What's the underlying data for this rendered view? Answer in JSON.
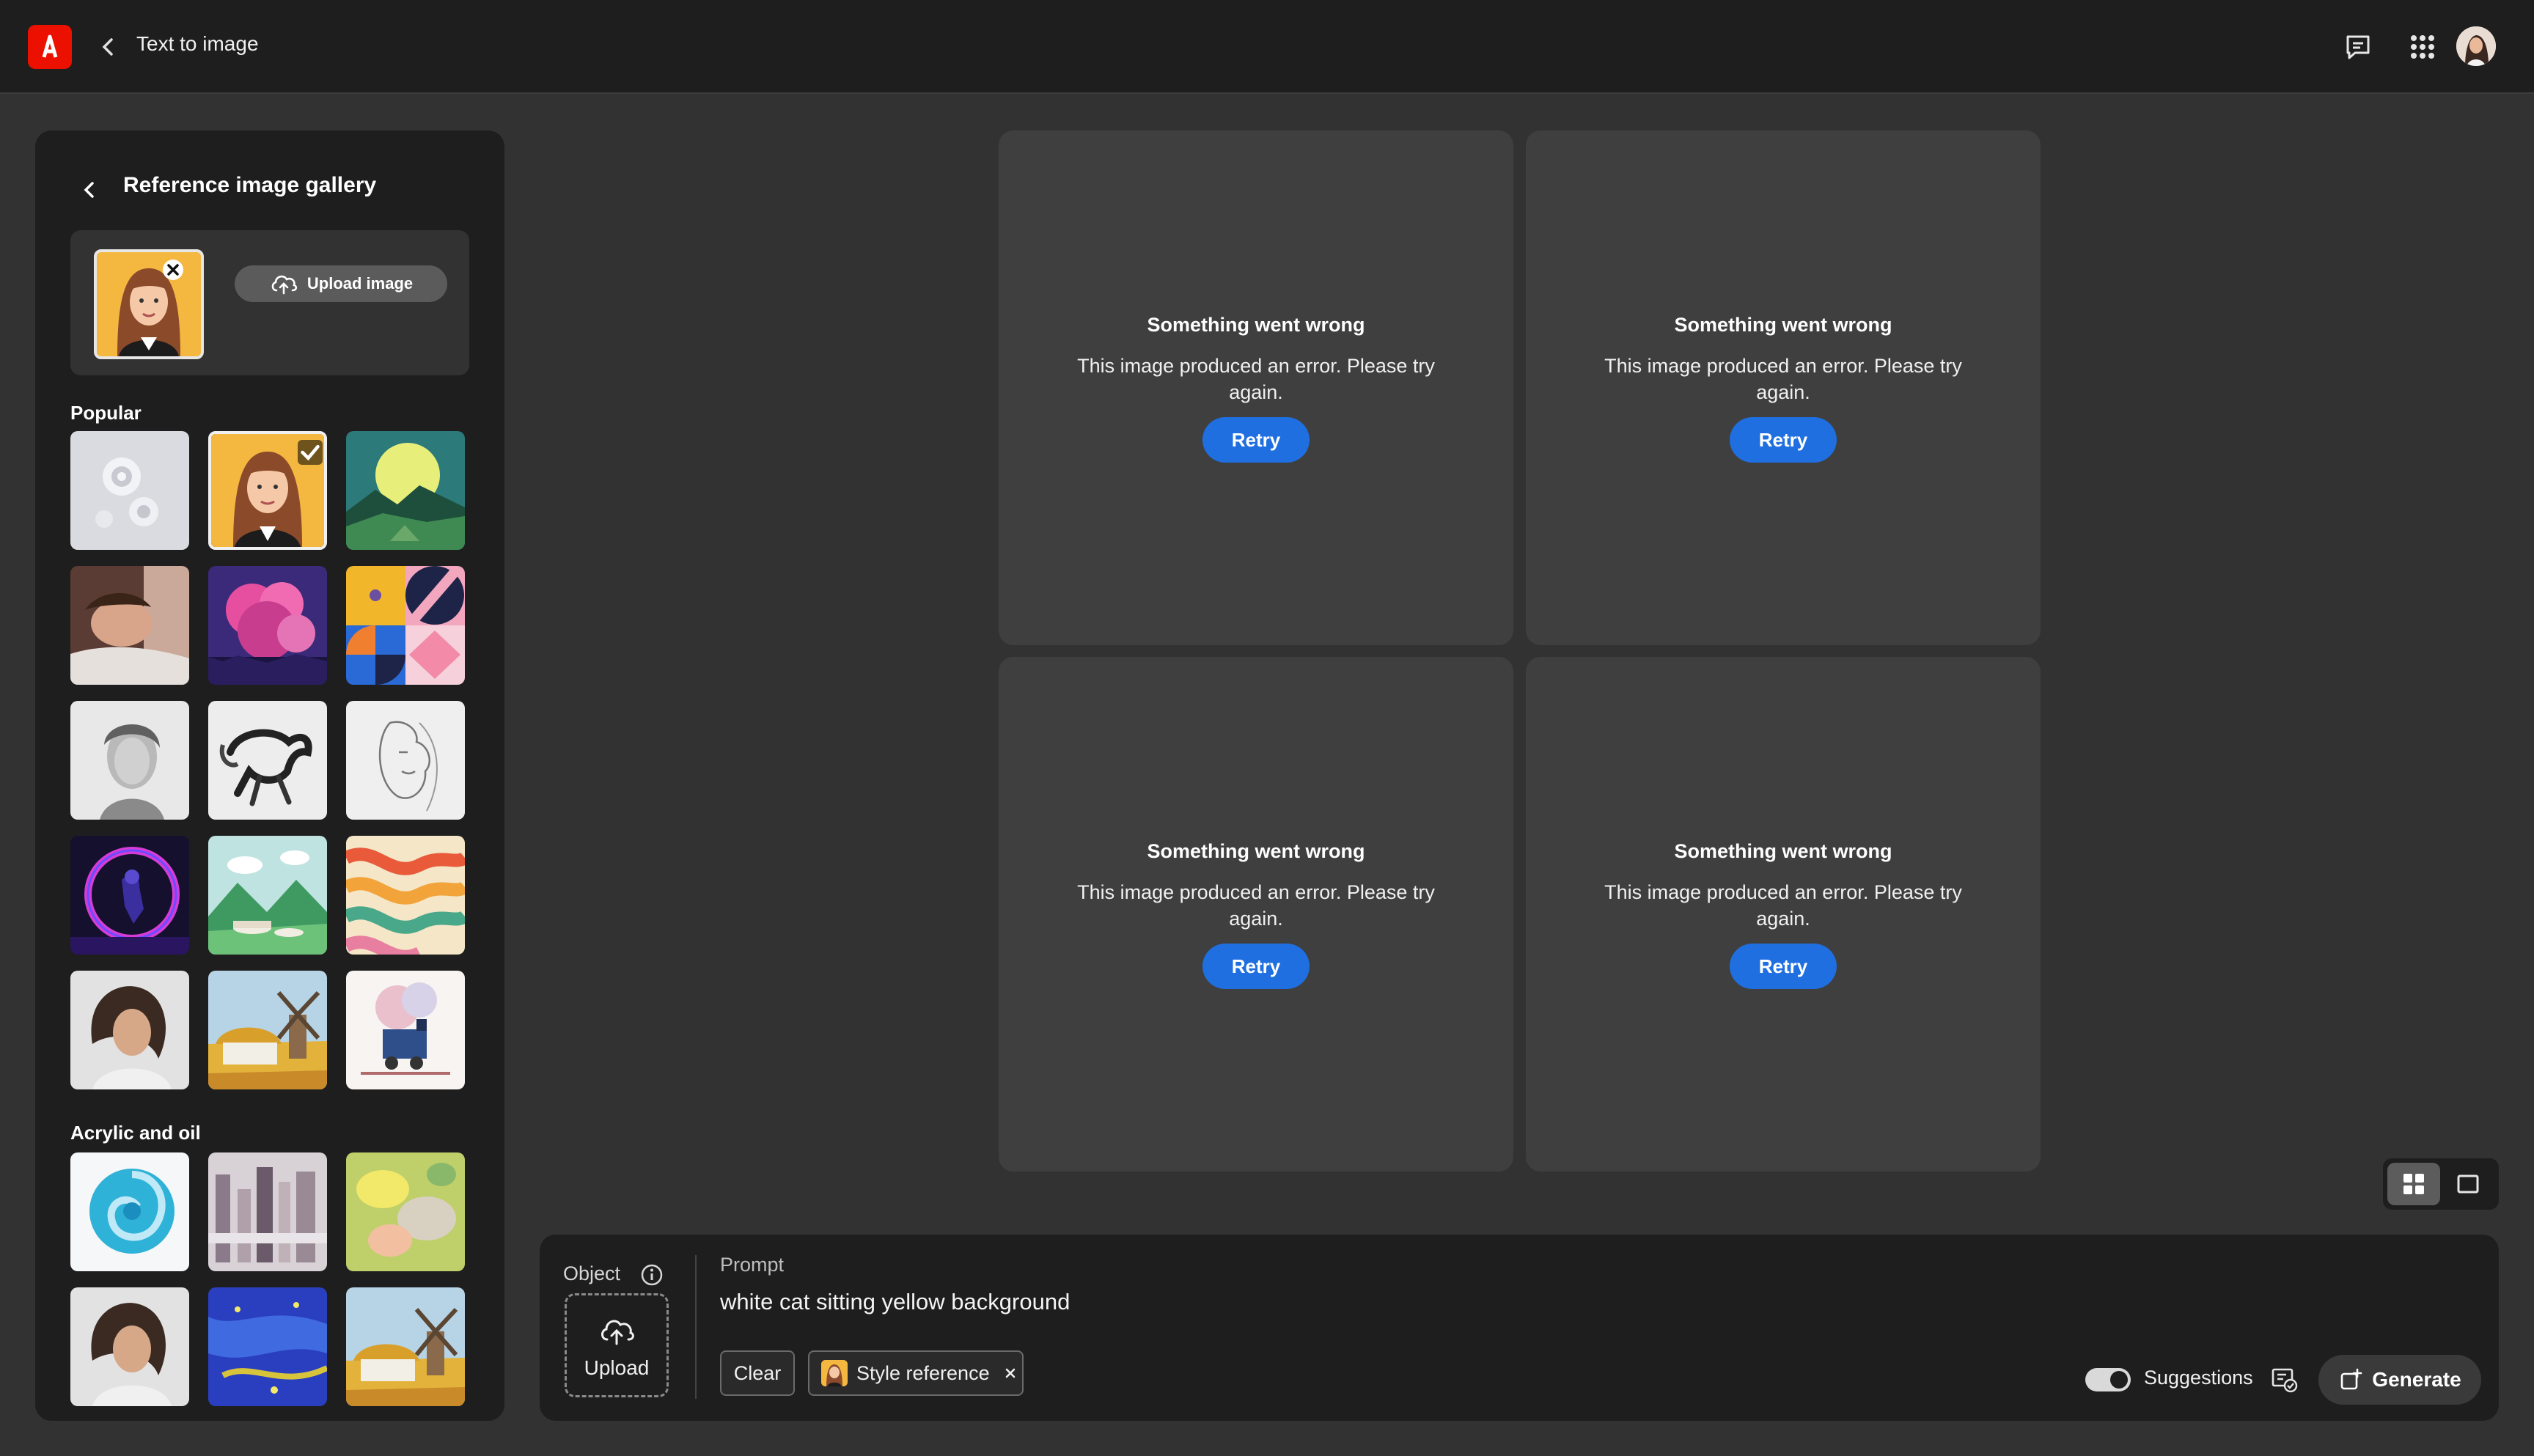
{
  "topbar": {
    "title": "Text to image"
  },
  "gallery": {
    "title": "Reference image gallery",
    "upload_label": "Upload image",
    "sections": {
      "popular": "Popular",
      "acrylic": "Acrylic and oil"
    }
  },
  "results": {
    "cards": [
      {
        "title": "Something went wrong",
        "message": "This image produced an error. Please try again.",
        "retry": "Retry"
      },
      {
        "title": "Something went wrong",
        "message": "This image produced an error. Please try again.",
        "retry": "Retry"
      },
      {
        "title": "Something went wrong",
        "message": "This image produced an error. Please try again.",
        "retry": "Retry"
      },
      {
        "title": "Something went wrong",
        "message": "This image produced an error. Please try again.",
        "retry": "Retry"
      }
    ]
  },
  "prompt": {
    "object_label": "Object",
    "upload_label": "Upload",
    "label": "Prompt",
    "text": "white cat sitting yellow background",
    "clear_label": "Clear",
    "style_chip": "Style reference",
    "suggestions_label": "Suggestions",
    "generate_label": "Generate"
  },
  "colors": {
    "accent_blue": "#1f6fe0",
    "brand_red": "#eb1000",
    "panel_bg": "#1e1e1e",
    "canvas_bg": "#323232",
    "card_bg": "#3f3f3f"
  },
  "icons": {
    "logo": "adobe-logo-icon",
    "back": "chevron-left-icon",
    "chat": "chat-icon",
    "apps": "apps-grid-icon",
    "upload": "cloud-upload-icon",
    "close": "close-icon",
    "check": "checkmark-icon",
    "info": "info-icon",
    "grid_view": "grid-view-icon",
    "single_view": "single-view-icon",
    "generate": "generate-icon"
  }
}
